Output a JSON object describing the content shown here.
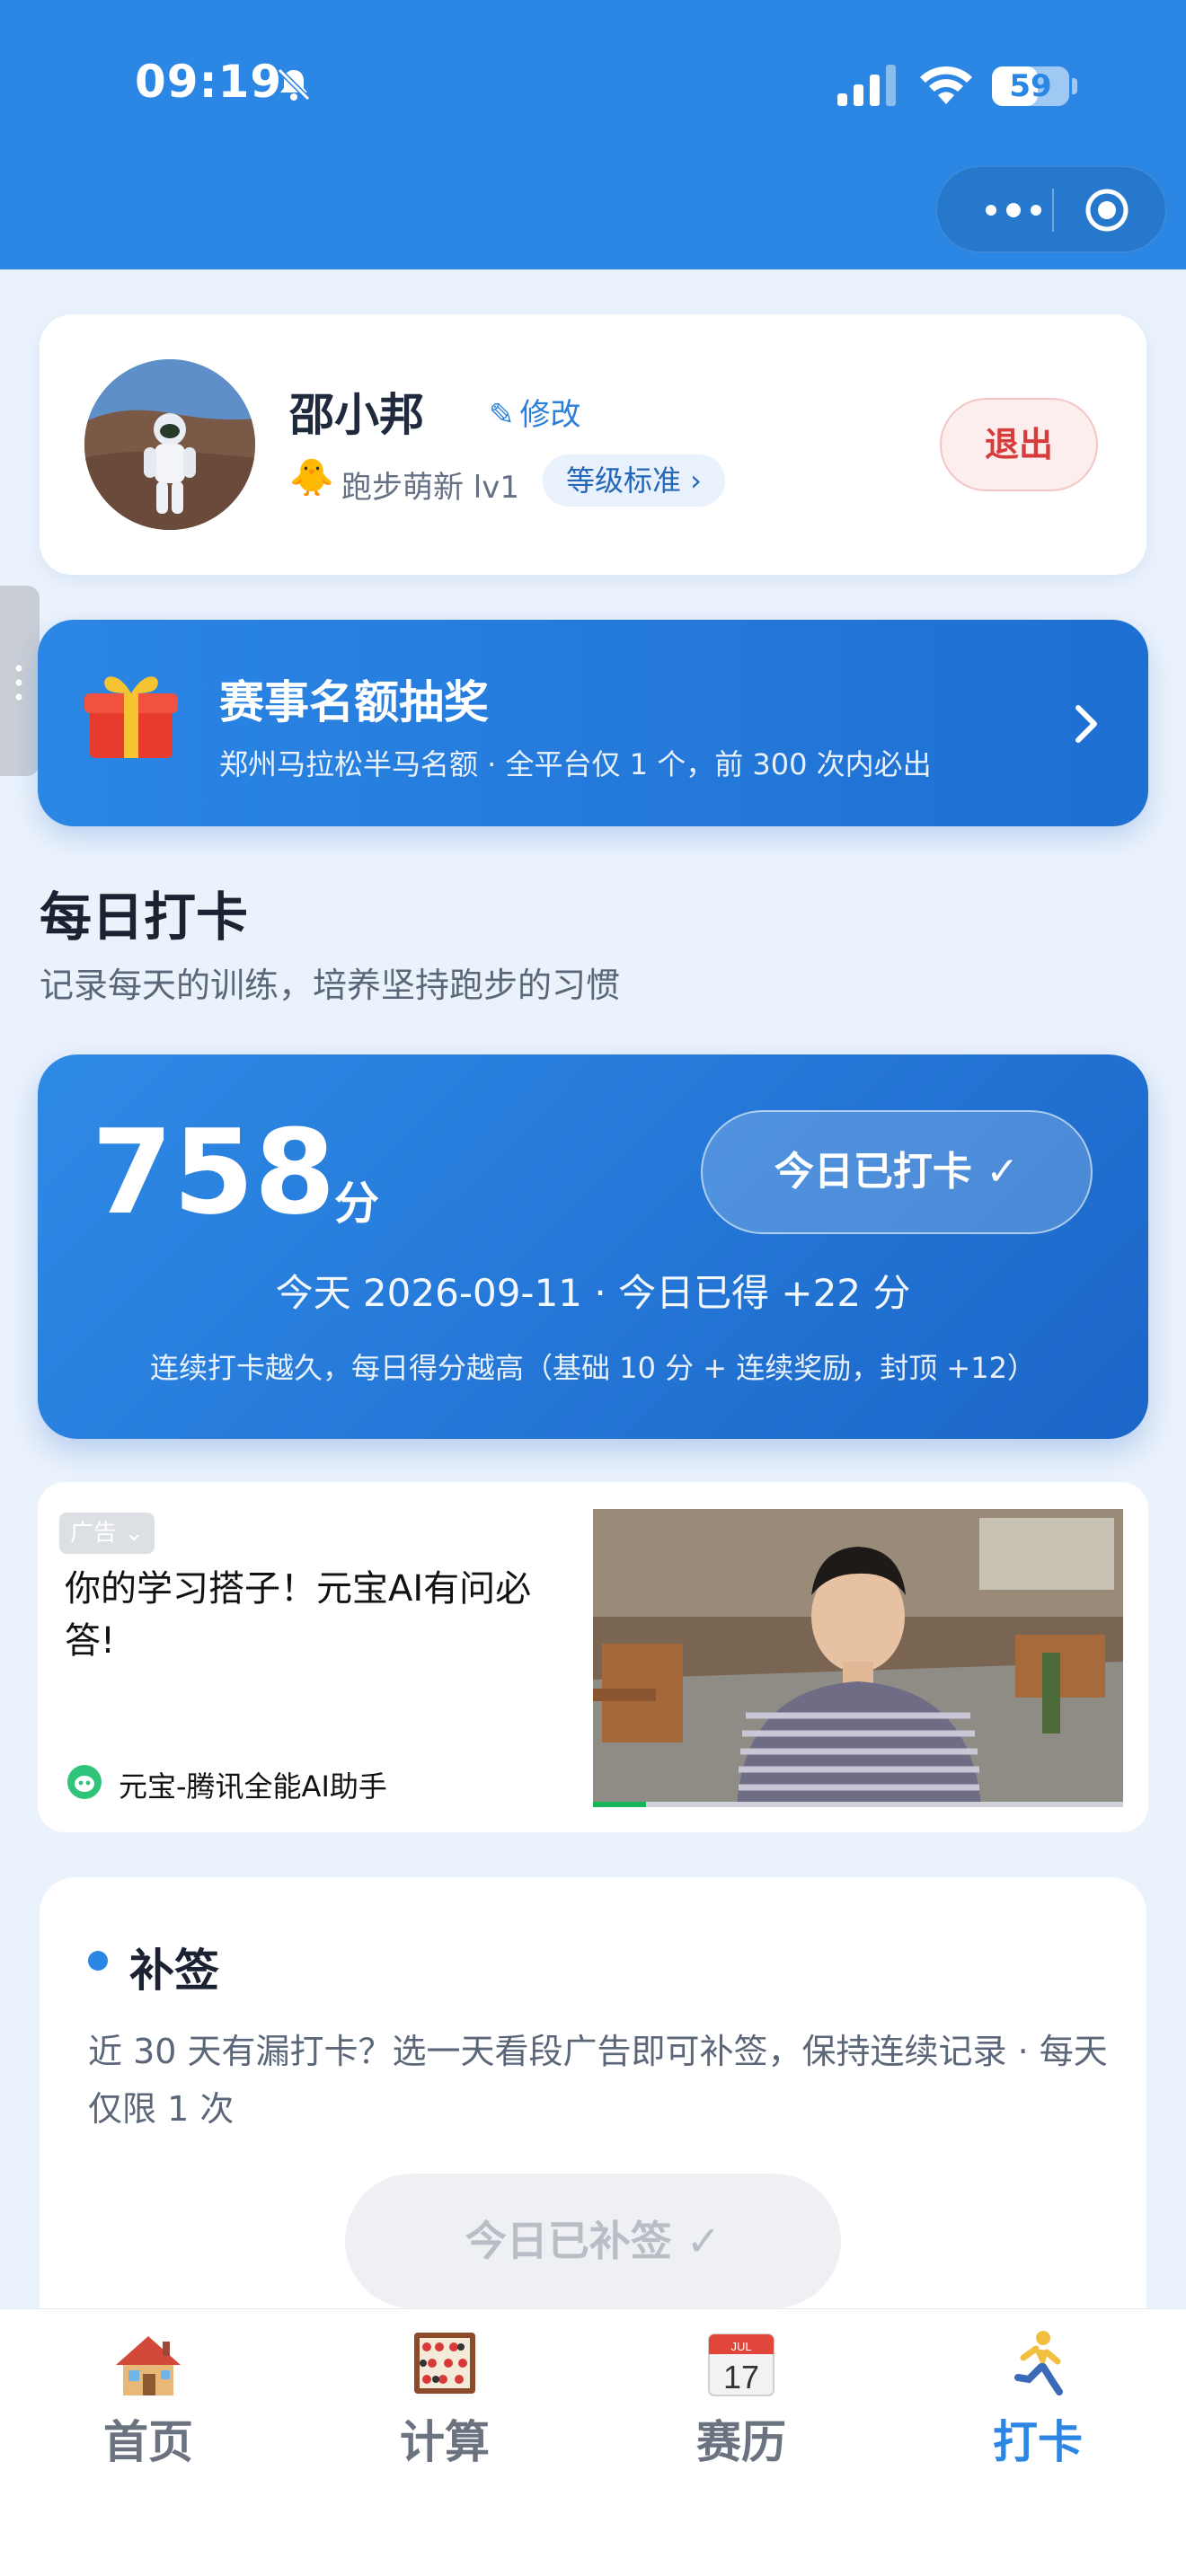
{
  "status_bar": {
    "time": "09:19",
    "battery": "59",
    "battery_level": 0.59
  },
  "profile": {
    "name": "邵小邦",
    "edit_label": "修改",
    "level_icon": "🐥",
    "level_text": "跑步萌新 lv1",
    "level_standard": "等级标准 ›",
    "logout_label": "退出"
  },
  "lottery": {
    "title": "赛事名额抽奖",
    "subtitle": "郑州马拉松半马名额 · 全平台仅 1 个，前 300 次内必出"
  },
  "checkin": {
    "title": "每日打卡",
    "subtitle": "记录每天的训练，培养坚持跑步的习惯",
    "score": "758",
    "score_unit": "分",
    "checked_label": "今日已打卡 ✓",
    "today_info": "今天 2026-09-11 · 今日已得 +22 分",
    "rule": "连续打卡越久，每日得分越高（基础 10 分 + 连续奖励，封顶 +12）"
  },
  "ad": {
    "badge": "广告",
    "title": "你的学习搭子！元宝AI有问必答!",
    "brand": "元宝-腾讯全能AI助手",
    "video_progress": 0.1
  },
  "makeup": {
    "title": "补签",
    "description": "近 30 天有漏打卡？选一天看段广告即可补签，保持连续记录 · 每天仅限 1 次",
    "button_label": "今日已补签 ✓"
  },
  "tabbar": {
    "tabs": [
      {
        "label": "首页",
        "icon": "house-icon"
      },
      {
        "label": "计算",
        "icon": "abacus-icon"
      },
      {
        "label": "赛历",
        "icon": "calendar-icon"
      },
      {
        "label": "打卡",
        "icon": "runner-icon"
      }
    ],
    "calendar_month": "JUL",
    "calendar_day": "17",
    "active_index": 3
  },
  "colors": {
    "primary": "#2b86e4",
    "danger": "#d73c3c",
    "background": "#eaf2fc"
  }
}
